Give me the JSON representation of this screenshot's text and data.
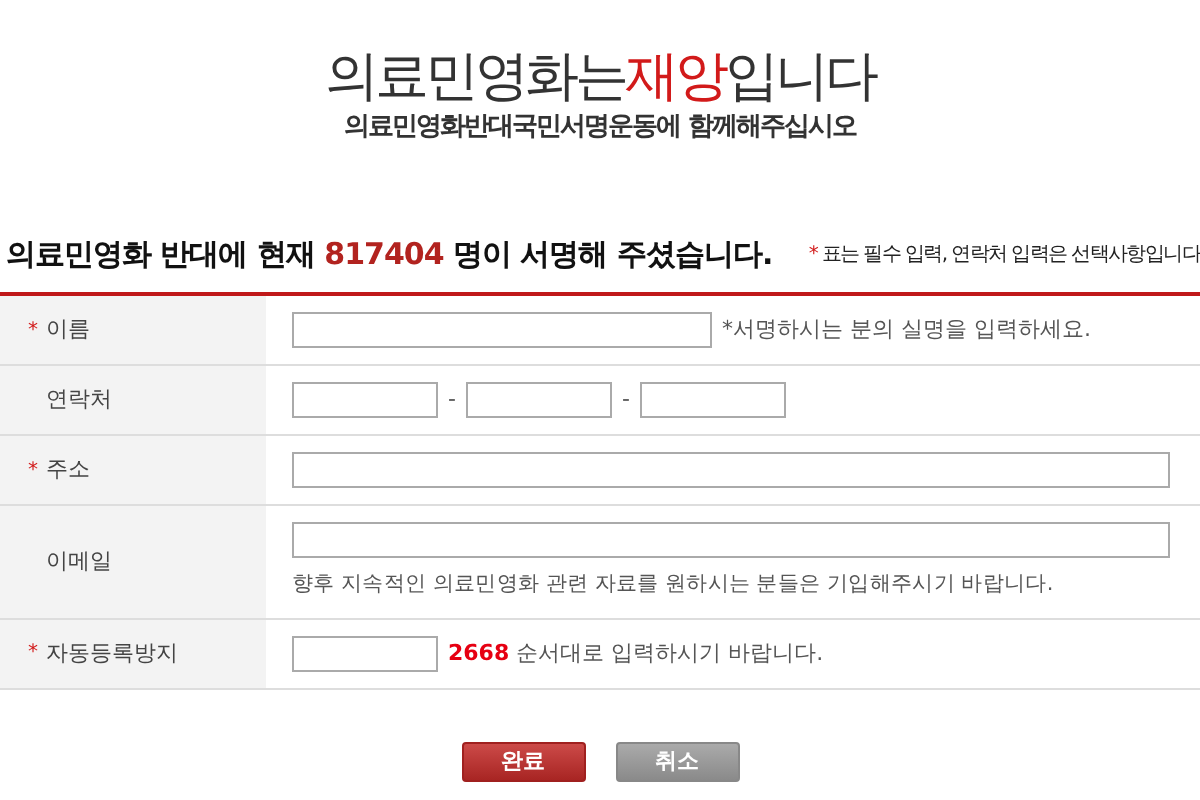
{
  "banner": {
    "headline_start": "의료민영화는",
    "headline_accent": "재앙",
    "headline_end": "입니다",
    "subtitle": "의료민영화반대국민서명운동에 함께해주십시오"
  },
  "counter": {
    "prefix": "의료민영화 반대에 현재",
    "count": "817404",
    "suffix": "명이 서명해 주셨습니다."
  },
  "notice": {
    "mark": "*",
    "text": "표는 필수 입력, 연락처 입력은 선택사항입니다"
  },
  "rows": [
    {
      "kind": "short_text",
      "label": "이름",
      "required": true,
      "hint": "*서명하시는 분의 실명을 입력하세요."
    },
    {
      "kind": "phone",
      "label": "연락처",
      "required": false,
      "separators": [
        "-",
        "-"
      ]
    },
    {
      "kind": "long_text",
      "label": "주소",
      "required": true
    },
    {
      "kind": "long_text",
      "label": "이메일",
      "required": false,
      "note": "향후 지속적인 의료민영화 관련 자료를 원하시는 분들은 기입해주시기 바랍니다."
    },
    {
      "kind": "captcha",
      "label": "자동등록방지",
      "required": true,
      "code": "2668",
      "hint": "순서대로 입력하시기 바랍니다."
    }
  ],
  "buttons": [
    {
      "label": "완료",
      "kind": "primary"
    },
    {
      "label": "취소",
      "kind": "secondary"
    }
  ]
}
